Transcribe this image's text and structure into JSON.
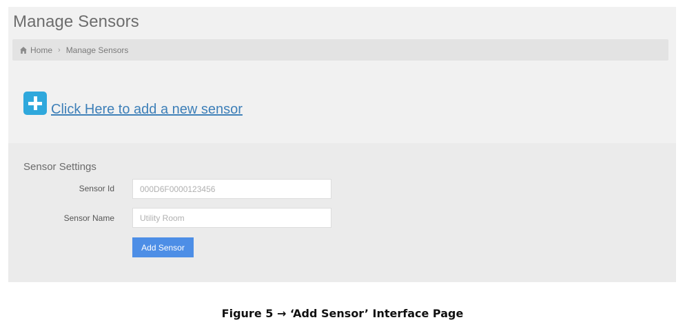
{
  "page": {
    "title": "Manage Sensors"
  },
  "breadcrumb": {
    "home_icon": "home-icon",
    "home_label": "Home",
    "separator": "›",
    "current_label": "Manage Sensors"
  },
  "add_link": {
    "icon": "plus-square-icon",
    "label": "Click Here to add a new sensor",
    "accent_color": "#2fa8dc"
  },
  "settings": {
    "title": "Sensor Settings",
    "sensor_id": {
      "label": "Sensor Id",
      "placeholder": "000D6F0000123456",
      "value": ""
    },
    "sensor_name": {
      "label": "Sensor Name",
      "placeholder": "Utility Room",
      "value": ""
    },
    "submit_label": "Add Sensor",
    "submit_color": "#4d8ee6"
  },
  "caption": "Figure 5 → ‘Add Sensor’ Interface Page"
}
